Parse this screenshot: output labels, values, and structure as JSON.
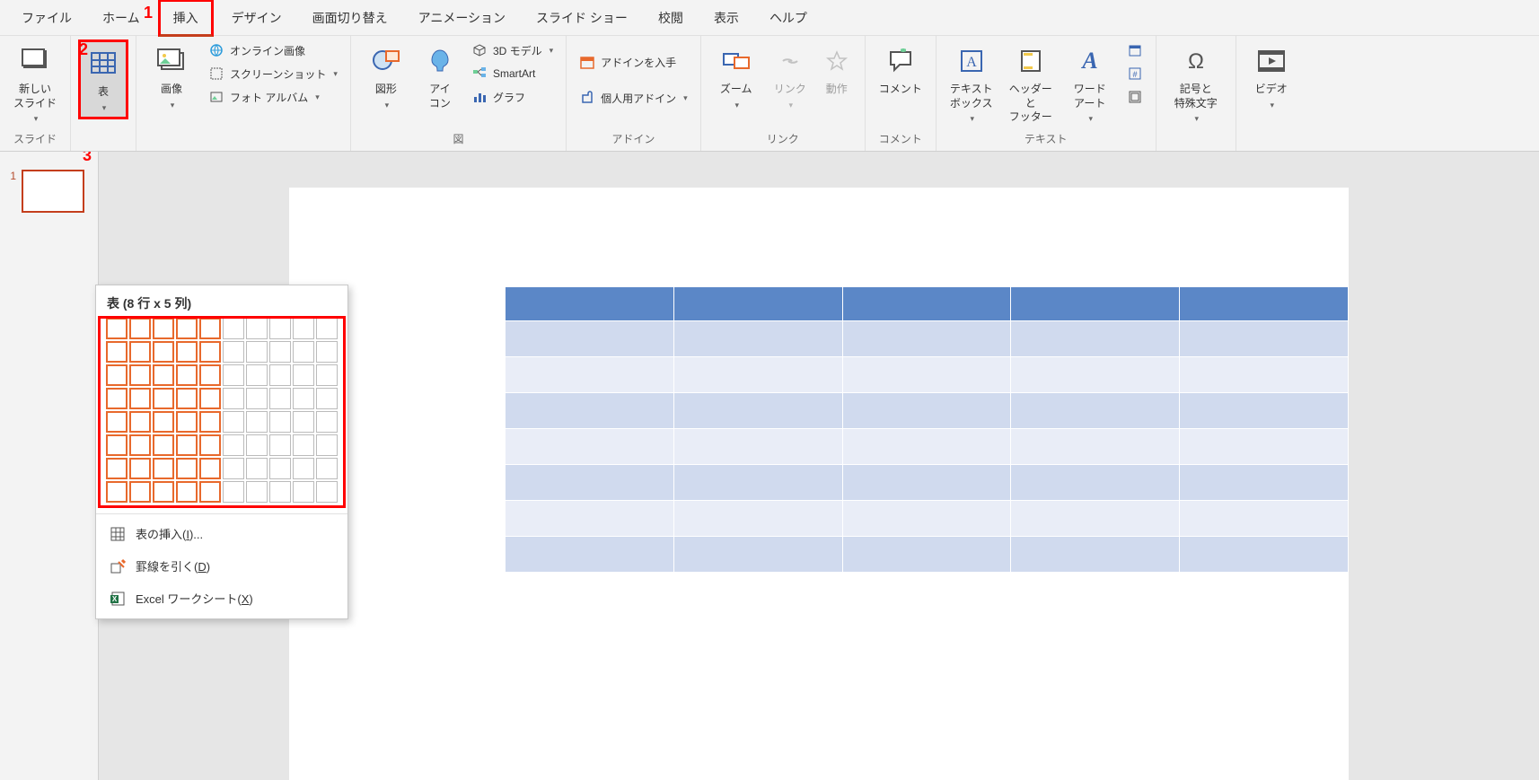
{
  "tabs": {
    "file": "ファイル",
    "home": "ホーム",
    "insert": "挿入",
    "design": "デザイン",
    "transition": "画面切り替え",
    "animation": "アニメーション",
    "slideshow": "スライド ショー",
    "review": "校閲",
    "view": "表示",
    "help": "ヘルプ"
  },
  "ribbon": {
    "slides": {
      "new_slide": "新しい\nスライド",
      "group": "スライド"
    },
    "tables": {
      "table": "表"
    },
    "images": {
      "pictures": "画像",
      "online": "オンライン画像",
      "screenshot": "スクリーンショット",
      "album": "フォト アルバム"
    },
    "illustrations": {
      "shapes": "図形",
      "icons": "アイ\nコン",
      "model3d": "3D モデル",
      "smartart": "SmartArt",
      "chart": "グラフ",
      "group": "図"
    },
    "addins": {
      "get": "アドインを入手",
      "my": "個人用アドイン",
      "group": "アドイン"
    },
    "links": {
      "zoom": "ズーム",
      "link": "リンク",
      "action": "動作",
      "group": "リンク"
    },
    "comments": {
      "comment": "コメント",
      "group": "コメント"
    },
    "text": {
      "textbox": "テキスト\nボックス",
      "headerfooter": "ヘッダーと\nフッター",
      "wordart": "ワード\nアート",
      "group": "テキスト"
    },
    "symbols": {
      "symbol": "記号と\n特殊文字"
    },
    "media": {
      "video": "ビデオ"
    }
  },
  "dropdown": {
    "title": "表 (8 行 x 5 列)",
    "rows_selected": 8,
    "cols_selected": 5,
    "grid_rows": 8,
    "grid_cols": 10,
    "insert_label_pre": "表の挿入(",
    "insert_key": "I",
    "insert_label_post": ")...",
    "draw_label_pre": "罫線を引く(",
    "draw_key": "D",
    "draw_label_post": ")",
    "excel_label_pre": "Excel ワークシート(",
    "excel_key": "X",
    "excel_label_post": ")"
  },
  "annotations": {
    "one": "1",
    "two": "2",
    "three": "3"
  },
  "thumb": {
    "num": "1"
  },
  "preview": {
    "rows": 8,
    "cols": 5
  }
}
